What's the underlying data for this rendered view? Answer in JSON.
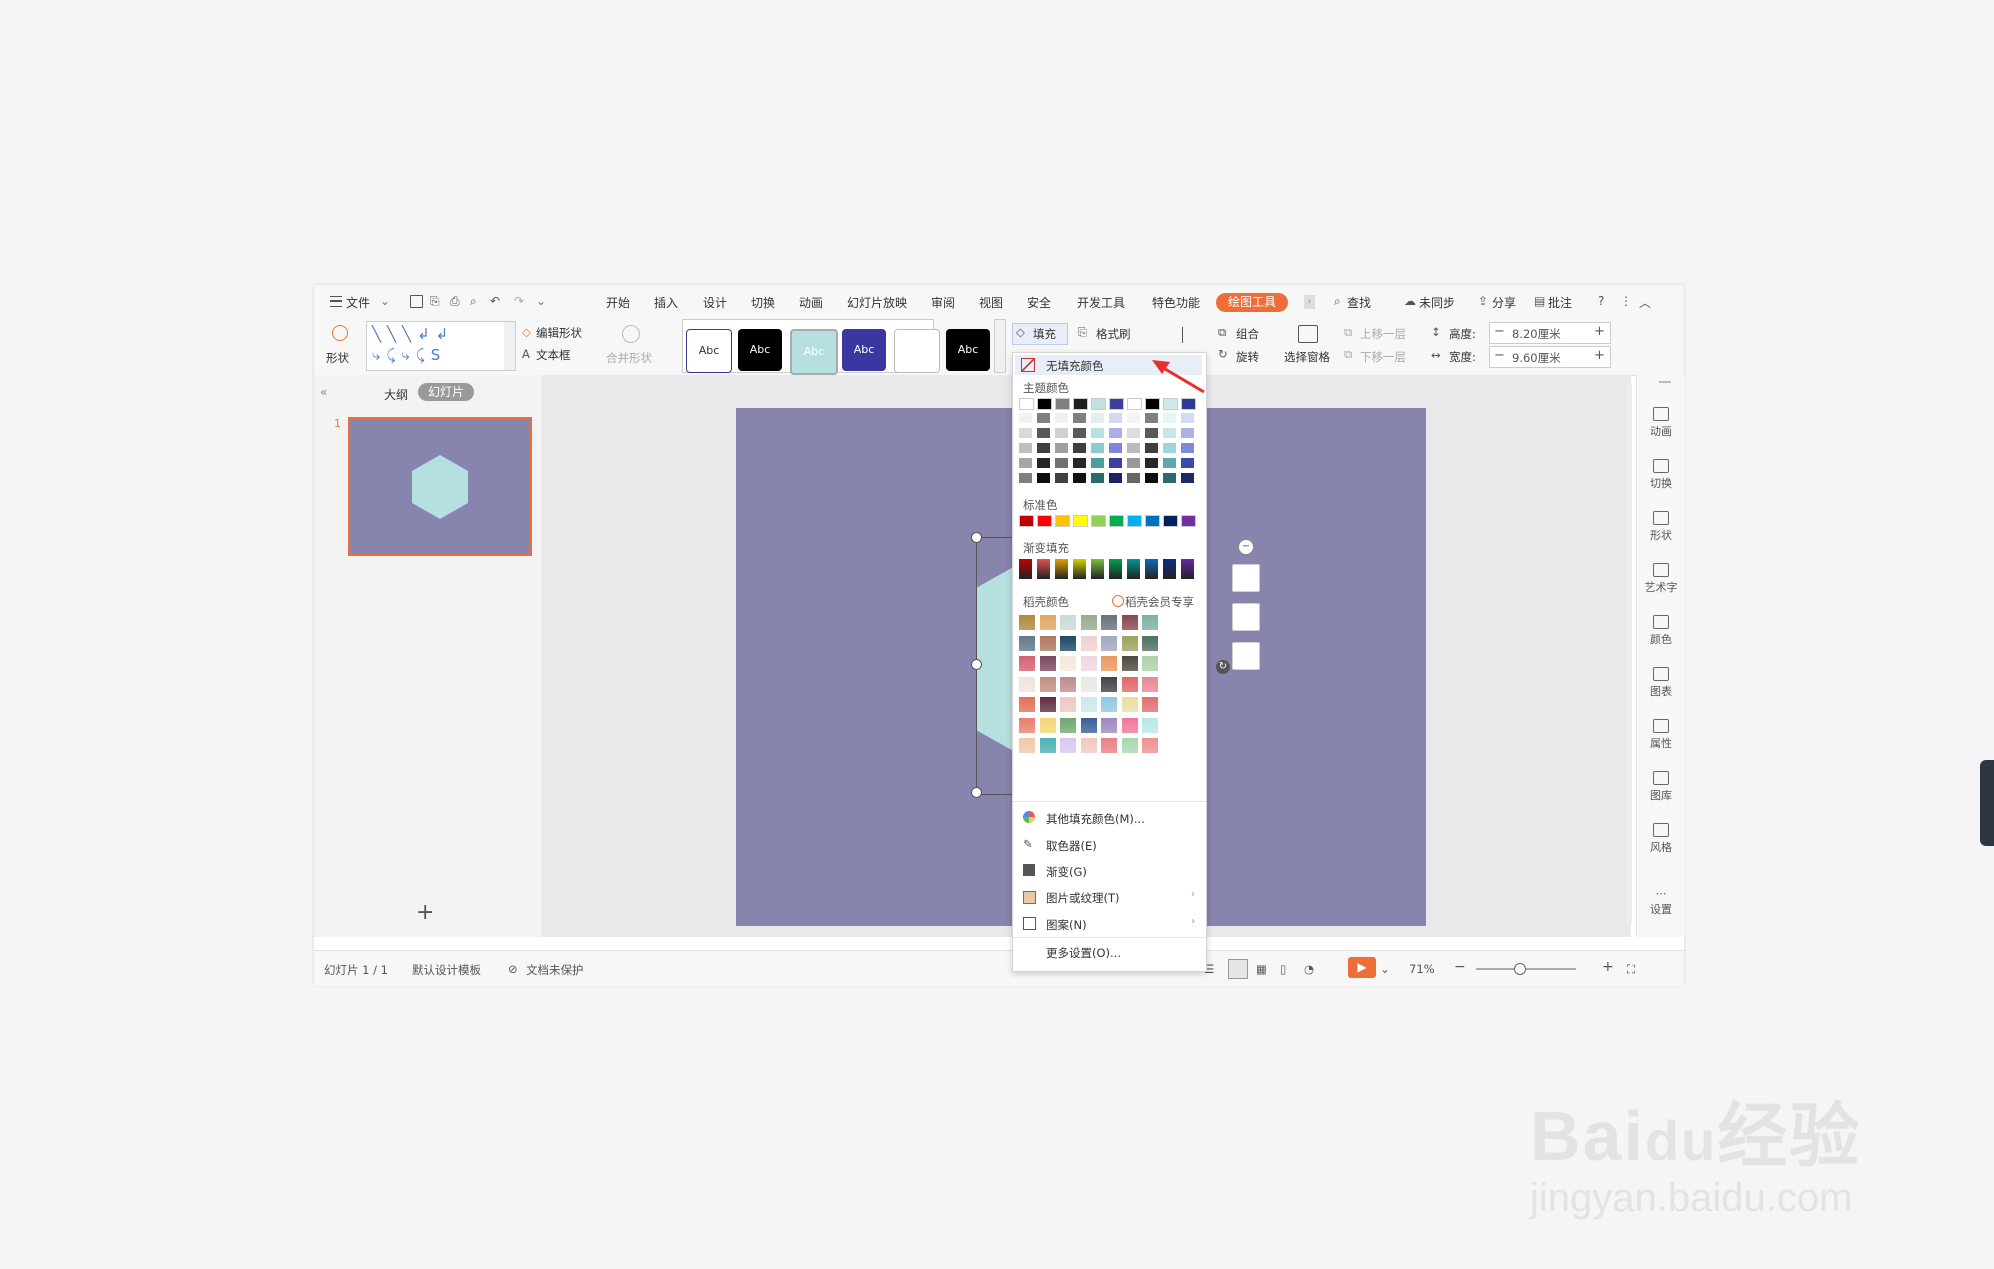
{
  "menu": {
    "file": "文件",
    "tabs": [
      "开始",
      "插入",
      "设计",
      "切换",
      "动画",
      "幻灯片放映",
      "审阅",
      "视图",
      "安全",
      "开发工具",
      "特色功能"
    ],
    "active_tab": "绘图工具",
    "search": "查找",
    "sync": "未同步",
    "share": "分享",
    "comment": "批注"
  },
  "ribbon": {
    "shape": "形状",
    "edit_shape": "编辑形状",
    "textbox": "文本框",
    "merge_shape": "合并形状",
    "style_label": "Abc",
    "fill": "填充",
    "format_painter": "格式刷",
    "group": "组合",
    "rotate": "旋转",
    "selection_pane": "选择窗格",
    "bring_forward": "上移一层",
    "send_backward": "下移一层",
    "height_label": "高度:",
    "height_value": "8.20厘米",
    "width_label": "宽度:",
    "width_value": "9.60厘米"
  },
  "left_panel": {
    "outline_tab": "大纲",
    "slides_tab": "幻灯片",
    "slide_number": "1"
  },
  "fill_menu": {
    "no_fill": "无填充颜色",
    "theme_colors": "主题颜色",
    "standard_colors": "标准色",
    "gradient_fill": "渐变填充",
    "docer_colors": "稻壳颜色",
    "docer_vip": "稻壳会员专享",
    "more_colors": "其他填充颜色(M)...",
    "eyedropper": "取色器(E)",
    "gradient": "渐变(G)",
    "picture_texture": "图片或纹理(T)",
    "pattern": "图案(N)",
    "more_settings": "更多设置(O)...",
    "theme_top_row": [
      "#ffffff",
      "#000000",
      "#7f7f7f",
      "#1f1f1f",
      "#c3e0e0",
      "#3b3f9a",
      "#ffffff",
      "#000000",
      "#cde8ec",
      "#2f3b8f"
    ],
    "standard_row": [
      "#c00000",
      "#ff0000",
      "#ffc000",
      "#ffff00",
      "#92d050",
      "#00b050",
      "#00b0f0",
      "#0070c0",
      "#002060",
      "#7030a0"
    ],
    "gradient_row": [
      "#c00000",
      "#e05050",
      "#e0a000",
      "#d6d000",
      "#7cc040",
      "#00a050",
      "#009a90",
      "#0a6ab8",
      "#102a80",
      "#6a2aa0"
    ]
  },
  "right_bar": [
    "动画",
    "切换",
    "形状",
    "艺术字",
    "颜色",
    "图表",
    "属性",
    "图库",
    "风格",
    "设置"
  ],
  "status": {
    "slide_info": "幻灯片 1 / 1",
    "template": "默认设计模板",
    "protect": "文档未保护",
    "zoom": "71%"
  },
  "colors": {
    "slide_bg": "#8784ad",
    "hexagon": "#b6dfe0",
    "accent": "#ee6e3a"
  }
}
